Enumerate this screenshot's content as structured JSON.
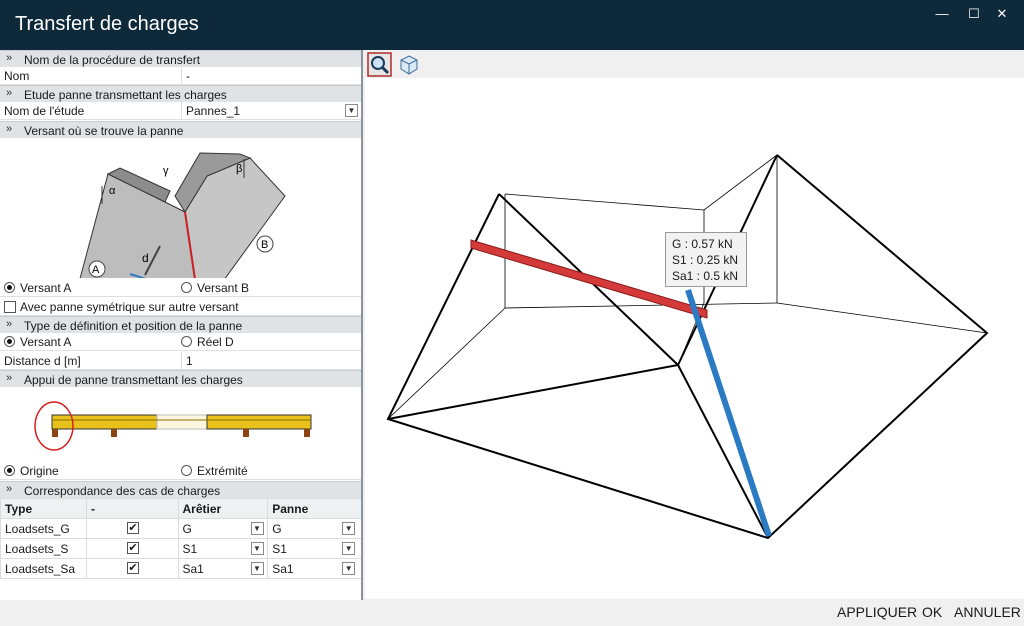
{
  "window": {
    "title": "Transfert de charges",
    "min_label": "—",
    "max_label": "☐",
    "close_label": "✕"
  },
  "sections": {
    "s1": "Nom de la procédure de transfert",
    "s2": "Etude panne transmettant les charges",
    "s3": "Versant où se trouve la panne",
    "s4": "Type de définition et position de la panne",
    "s5": "Appui de panne transmettant les charges",
    "s6": "Correspondance des cas de charges"
  },
  "fields": {
    "nom_label": "Nom",
    "nom_value": "-",
    "etude_label": "Nom de l'étude",
    "etude_value": "Pannes_1",
    "distance_label": "Distance d  [m]",
    "distance_value": "1"
  },
  "diagram": {
    "alpha": "α",
    "beta": "β",
    "gamma": "γ",
    "d": "d",
    "a": "A",
    "b": "B"
  },
  "versant": {
    "a": "Versant A",
    "b": "Versant B",
    "selected": "a"
  },
  "symmetric": {
    "label": "Avec panne symétrique sur autre versant",
    "checked": false
  },
  "typedef": {
    "a": "Versant A",
    "b": "Réel D",
    "selected": "a"
  },
  "appui": {
    "a": "Origine",
    "b": "Extrémité",
    "selected": "a"
  },
  "loadcases": {
    "headers": [
      "Type",
      "-",
      "Arêtier",
      "Panne"
    ],
    "rows": [
      {
        "type": "Loadsets_G",
        "checked": true,
        "aretier": "G",
        "panne": "G"
      },
      {
        "type": "Loadsets_S",
        "checked": true,
        "aretier": "S1",
        "panne": "S1"
      },
      {
        "type": "Loadsets_Sa",
        "checked": true,
        "aretier": "Sa1",
        "panne": "Sa1"
      }
    ]
  },
  "toolbar": {
    "zoom_icon": "zoom-icon",
    "view3d_icon": "cube-view-icon"
  },
  "tooltip": {
    "g": "G : 0.57 kN",
    "s1": "S1 : 0.25 kN",
    "sa1": "Sa1 : 0.5 kN"
  },
  "footer": {
    "apply": "APPLIQUER",
    "ok": "OK",
    "cancel": "ANNULER"
  },
  "colors": {
    "titlebar": "#0e2a3a",
    "panne": "#d43a3a",
    "aretier": "#2a7bc4",
    "beam": "#e8c21a"
  }
}
